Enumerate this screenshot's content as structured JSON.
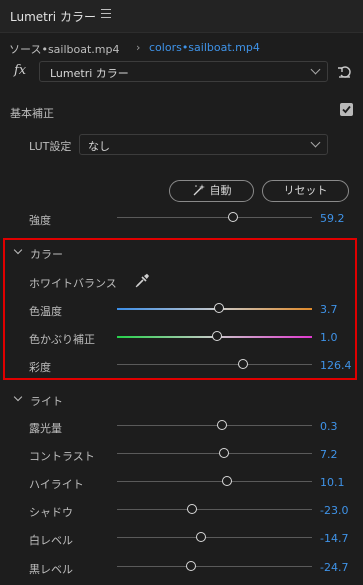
{
  "header": {
    "title": "Lumetri カラー"
  },
  "breadcrumb": {
    "source": "ソース•sailboat.mp4",
    "arrow": "›",
    "target": "colors•sailboat.mp4"
  },
  "effect": {
    "fx_label": "fx",
    "selected": "Lumetri カラー"
  },
  "basic": {
    "label": "基本補正",
    "checked": true,
    "lut_label": "LUT設定",
    "lut_value": "なし",
    "auto_label": "自動",
    "reset_label": "リセット",
    "intensity": {
      "label": "強度",
      "value": "59.2"
    }
  },
  "color": {
    "label": "カラー",
    "wb_label": "ホワイトバランス",
    "temperature": {
      "label": "色温度",
      "value": "3.7"
    },
    "tint": {
      "label": "色かぶり補正",
      "value": "1.0"
    },
    "saturation": {
      "label": "彩度",
      "value": "126.4"
    }
  },
  "light": {
    "label": "ライト",
    "rows": [
      {
        "label": "露光量",
        "value": "0.3"
      },
      {
        "label": "コントラスト",
        "value": "7.2"
      },
      {
        "label": "ハイライト",
        "value": "10.1"
      },
      {
        "label": "シャドウ",
        "value": "-23.0"
      },
      {
        "label": "白レベル",
        "value": "-14.7"
      },
      {
        "label": "黒レベル",
        "value": "-24.7"
      }
    ]
  },
  "colors": {
    "accent": "#3f93e8",
    "highlight": "#e00000"
  }
}
